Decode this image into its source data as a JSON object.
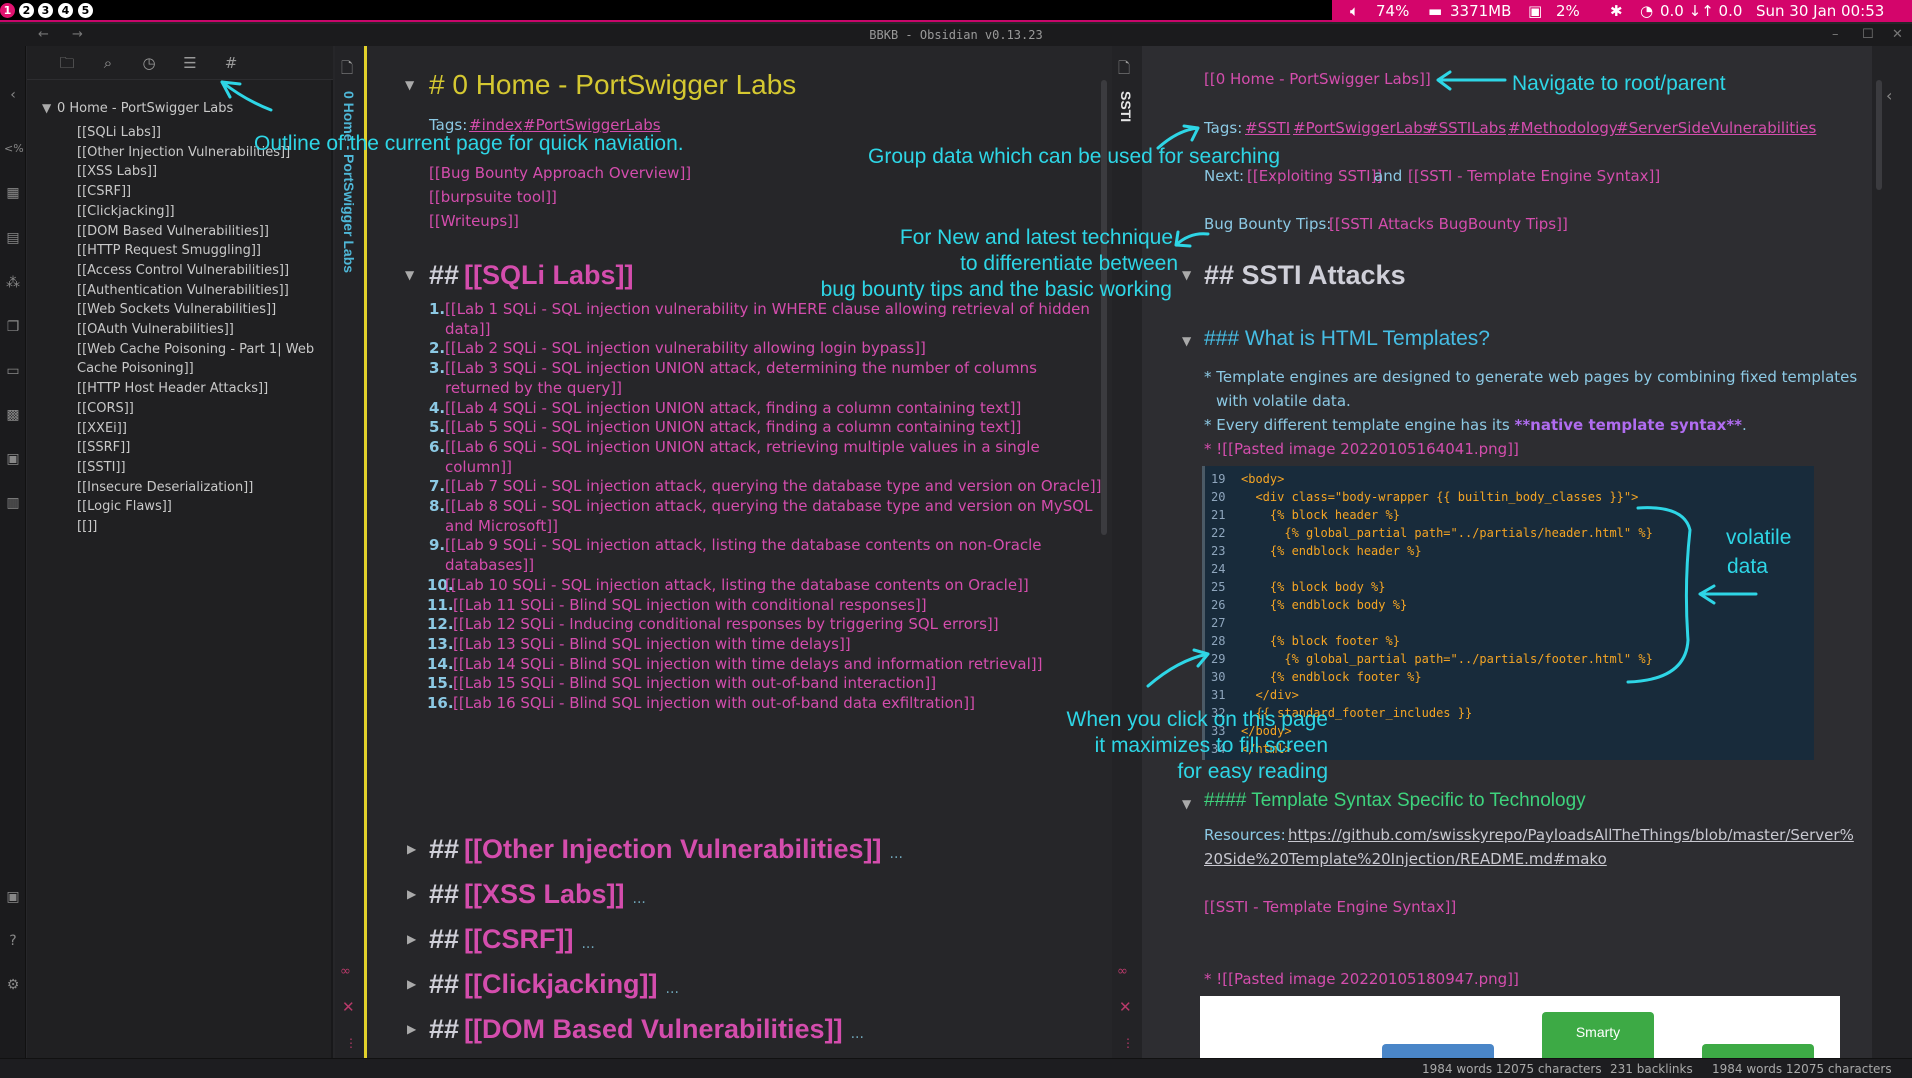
{
  "system_bar": {
    "workspaces": [
      "1",
      "2",
      "3",
      "4",
      "5"
    ],
    "volume": "74%",
    "memory": "3371MB",
    "cpu": "2%",
    "network": "0.0 ↓↑ 0.0",
    "datetime": "Sun 30 Jan 00:53"
  },
  "window": {
    "title": "BBKB - Obsidian v0.13.23",
    "back": "←",
    "forward": "→",
    "min": "–",
    "max": "☐",
    "close": "✕"
  },
  "outline": {
    "root": "0 Home - PortSwigger Labs",
    "items": [
      "[[SQLi Labs]]",
      "[[Other Injection Vulnerabilities]]",
      "[[XSS Labs]]",
      "[[CSRF]]",
      "[[Clickjacking]]",
      "[[DOM Based Vulnerabilities]]",
      "[[HTTP Request Smuggling]]",
      "[[Access Control Vulnerabilities]]",
      "[[Authentication Vulnerabilities]]",
      "[[Web Sockets Vulnerabilities]]",
      "[[OAuth Vulnerabilities]]",
      "[[Web Cache Poisoning - Part 1| Web",
      "Cache Poisoning]]",
      "[[HTTP Host Header Attacks]]",
      "[[CORS]]",
      "[[XXEi]]",
      "[[SSRF]]",
      "[[SSTI]]",
      "[[Insecure Deserialization]]",
      "[[Logic Flaws]]",
      "[[]]"
    ]
  },
  "pane1": {
    "vertical_title": "0 Home - PortSwigger Labs",
    "h1": "# 0 Home - PortSwigger Labs",
    "tags_label": "Tags:",
    "tags": [
      "#index",
      "#PortSwiggerLabs"
    ],
    "links": [
      "[[Bug Bounty Approach Overview]]",
      "[[burpsuite tool]]",
      "[[Writeups]]"
    ],
    "h2_sqli_prefix": "## ",
    "h2_sqli": "[[SQLi Labs]]",
    "labs": [
      {
        "n": "1.",
        "t": "[[Lab 1 SQLi - SQL injection vulnerability in WHERE clause allowing retrieval of hidden"
      },
      {
        "n": "",
        "t": "data]]"
      },
      {
        "n": "2.",
        "t": "[[Lab 2 SQLi - SQL injection vulnerability allowing login bypass]]"
      },
      {
        "n": "3.",
        "t": "[[Lab 3 SQLi - SQL injection UNION attack, determining the number of columns"
      },
      {
        "n": "",
        "t": "returned by the query]]"
      },
      {
        "n": "4.",
        "t": "[[Lab 4 SQLi - SQL injection UNION attack, finding a column containing text]]"
      },
      {
        "n": "5.",
        "t": "[[Lab 5 SQLi - SQL injection UNION attack, finding a column containing text]]"
      },
      {
        "n": "6.",
        "t": "[[Lab 6 SQLi - SQL injection UNION attack, retrieving multiple values in a single"
      },
      {
        "n": "",
        "t": "column]]"
      },
      {
        "n": "7.",
        "t": "[[Lab 7 SQLi - SQL injection attack, querying the database type and version on Oracle]]"
      },
      {
        "n": "8.",
        "t": "[[Lab 8 SQLi - SQL injection attack, querying the database type and version on MySQL"
      },
      {
        "n": "",
        "t": "and Microsoft]]"
      },
      {
        "n": "9.",
        "t": "[[Lab 9 SQLi - SQL injection attack, listing the database contents on non-Oracle"
      },
      {
        "n": "",
        "t": "databases]]"
      },
      {
        "n": "10.",
        "t": "[[Lab 10 SQLi - SQL injection attack, listing the database contents on Oracle]]"
      },
      {
        "n": "11.",
        "t": "[[Lab 11 SQLi - Blind SQL injection with conditional responses]]"
      },
      {
        "n": "12.",
        "t": "[[Lab 12 SQLi - Inducing conditional responses by triggering SQL errors]]"
      },
      {
        "n": "13.",
        "t": "[[Lab 13 SQLi - Blind SQL injection with time delays]]"
      },
      {
        "n": "14.",
        "t": "[[Lab 14 SQLi -  Blind SQL injection with time delays and information retrieval]]"
      },
      {
        "n": "15.",
        "t": "[[Lab 15 SQLi - Blind SQL injection with out-of-band interaction]]"
      },
      {
        "n": "16.",
        "t": "[[Lab 16 SQLi - Blind SQL injection with out-of-band data exfiltration]]"
      }
    ],
    "collapsed": [
      "[[Other Injection Vulnerabilities]]",
      "[[XSS Labs]]",
      "[[CSRF]]",
      "[[Clickjacking]]",
      "[[DOM Based Vulnerabilities]]"
    ],
    "collapsed_prefix": "## ",
    "ellipsis": "..."
  },
  "pane2": {
    "vertical_title": "SSTI",
    "root_link": "[[0 Home - PortSwigger Labs]]",
    "tags_label": "Tags:",
    "tags": [
      "#SSTI",
      "#PortSwiggerLabs",
      "#SSTILabs",
      "#Methodology",
      "#ServerSideVulnerabilities"
    ],
    "next_label": "Next:",
    "next_link1": "[[Exploiting SSTI]]",
    "next_and": "and",
    "next_link2": "[[SSTI - Template Engine Syntax]]",
    "tips_label": "Bug Bounty Tips:",
    "tips_link": "[[SSTI Attacks BugBounty Tips]]",
    "h2": "## SSTI Attacks",
    "h3": "### What is HTML Templates?",
    "b1a": "* Template engines are designed to generate web pages by combining fixed templates",
    "b1b": "with volatile data.",
    "b2a": "* Every different template engine has its ",
    "b2b": "**native template syntax**",
    "b2c": ".",
    "b3": "* ![[Pasted image 20220105164041.png]]",
    "h4": "#### Template Syntax Specific to Technology",
    "res_label": "Resources:",
    "res_url1": "https://github.com/swisskyrepo/PayloadsAllTheThings/blob/master/Server%",
    "res_url2": "20Side%20Template%20Injection/README.md#mako",
    "syntax_link": "[[SSTI - Template Engine Syntax]]",
    "b4": "* ![[Pasted image 20220105180947.png]]",
    "diagram_label": "Smarty"
  },
  "code_lines": [
    {
      "n": "19",
      "c": "<body>"
    },
    {
      "n": "20",
      "c": "  <div class=\"body-wrapper {{ builtin_body_classes }}\">"
    },
    {
      "n": "21",
      "c": "    {% block header %}"
    },
    {
      "n": "22",
      "c": "      {% global_partial path=\"../partials/header.html\" %}"
    },
    {
      "n": "23",
      "c": "    {% endblock header %}"
    },
    {
      "n": "24",
      "c": ""
    },
    {
      "n": "25",
      "c": "    {% block body %}"
    },
    {
      "n": "26",
      "c": "    {% endblock body %}"
    },
    {
      "n": "27",
      "c": ""
    },
    {
      "n": "28",
      "c": "    {% block footer %}"
    },
    {
      "n": "29",
      "c": "      {% global_partial path=\"../partials/footer.html\" %}"
    },
    {
      "n": "30",
      "c": "    {% endblock footer %}"
    },
    {
      "n": "31",
      "c": "  </div>"
    },
    {
      "n": "32",
      "c": "  {{ standard_footer_includes }}"
    },
    {
      "n": "33",
      "c": "</body>"
    },
    {
      "n": "34",
      "c": "</html>"
    }
  ],
  "annotations": {
    "outline": "Outline of the current page for quick naviation.",
    "navigate": "Navigate to root/parent",
    "group": "Group data which can be used for searching",
    "tips1": "For New and latest technique",
    "tips2": "to differentiate between",
    "tips3": "bug bounty tips and the basic working",
    "volatile1": "volatile",
    "volatile2": "data",
    "max1": "When you click on this page",
    "max2": "it maximizes to fill screen",
    "max3": "for easy reading"
  },
  "status": {
    "words1": "1984 words 12075 characters",
    "backlinks": "231 backlinks",
    "words2": "1984 words  12075 characters"
  },
  "colors": {
    "accent": "#d4056b",
    "link": "#d44dad",
    "h1": "#d5c831",
    "h3": "#46bde4",
    "h4": "#3ed37d",
    "annotation": "#2ed6e6"
  }
}
